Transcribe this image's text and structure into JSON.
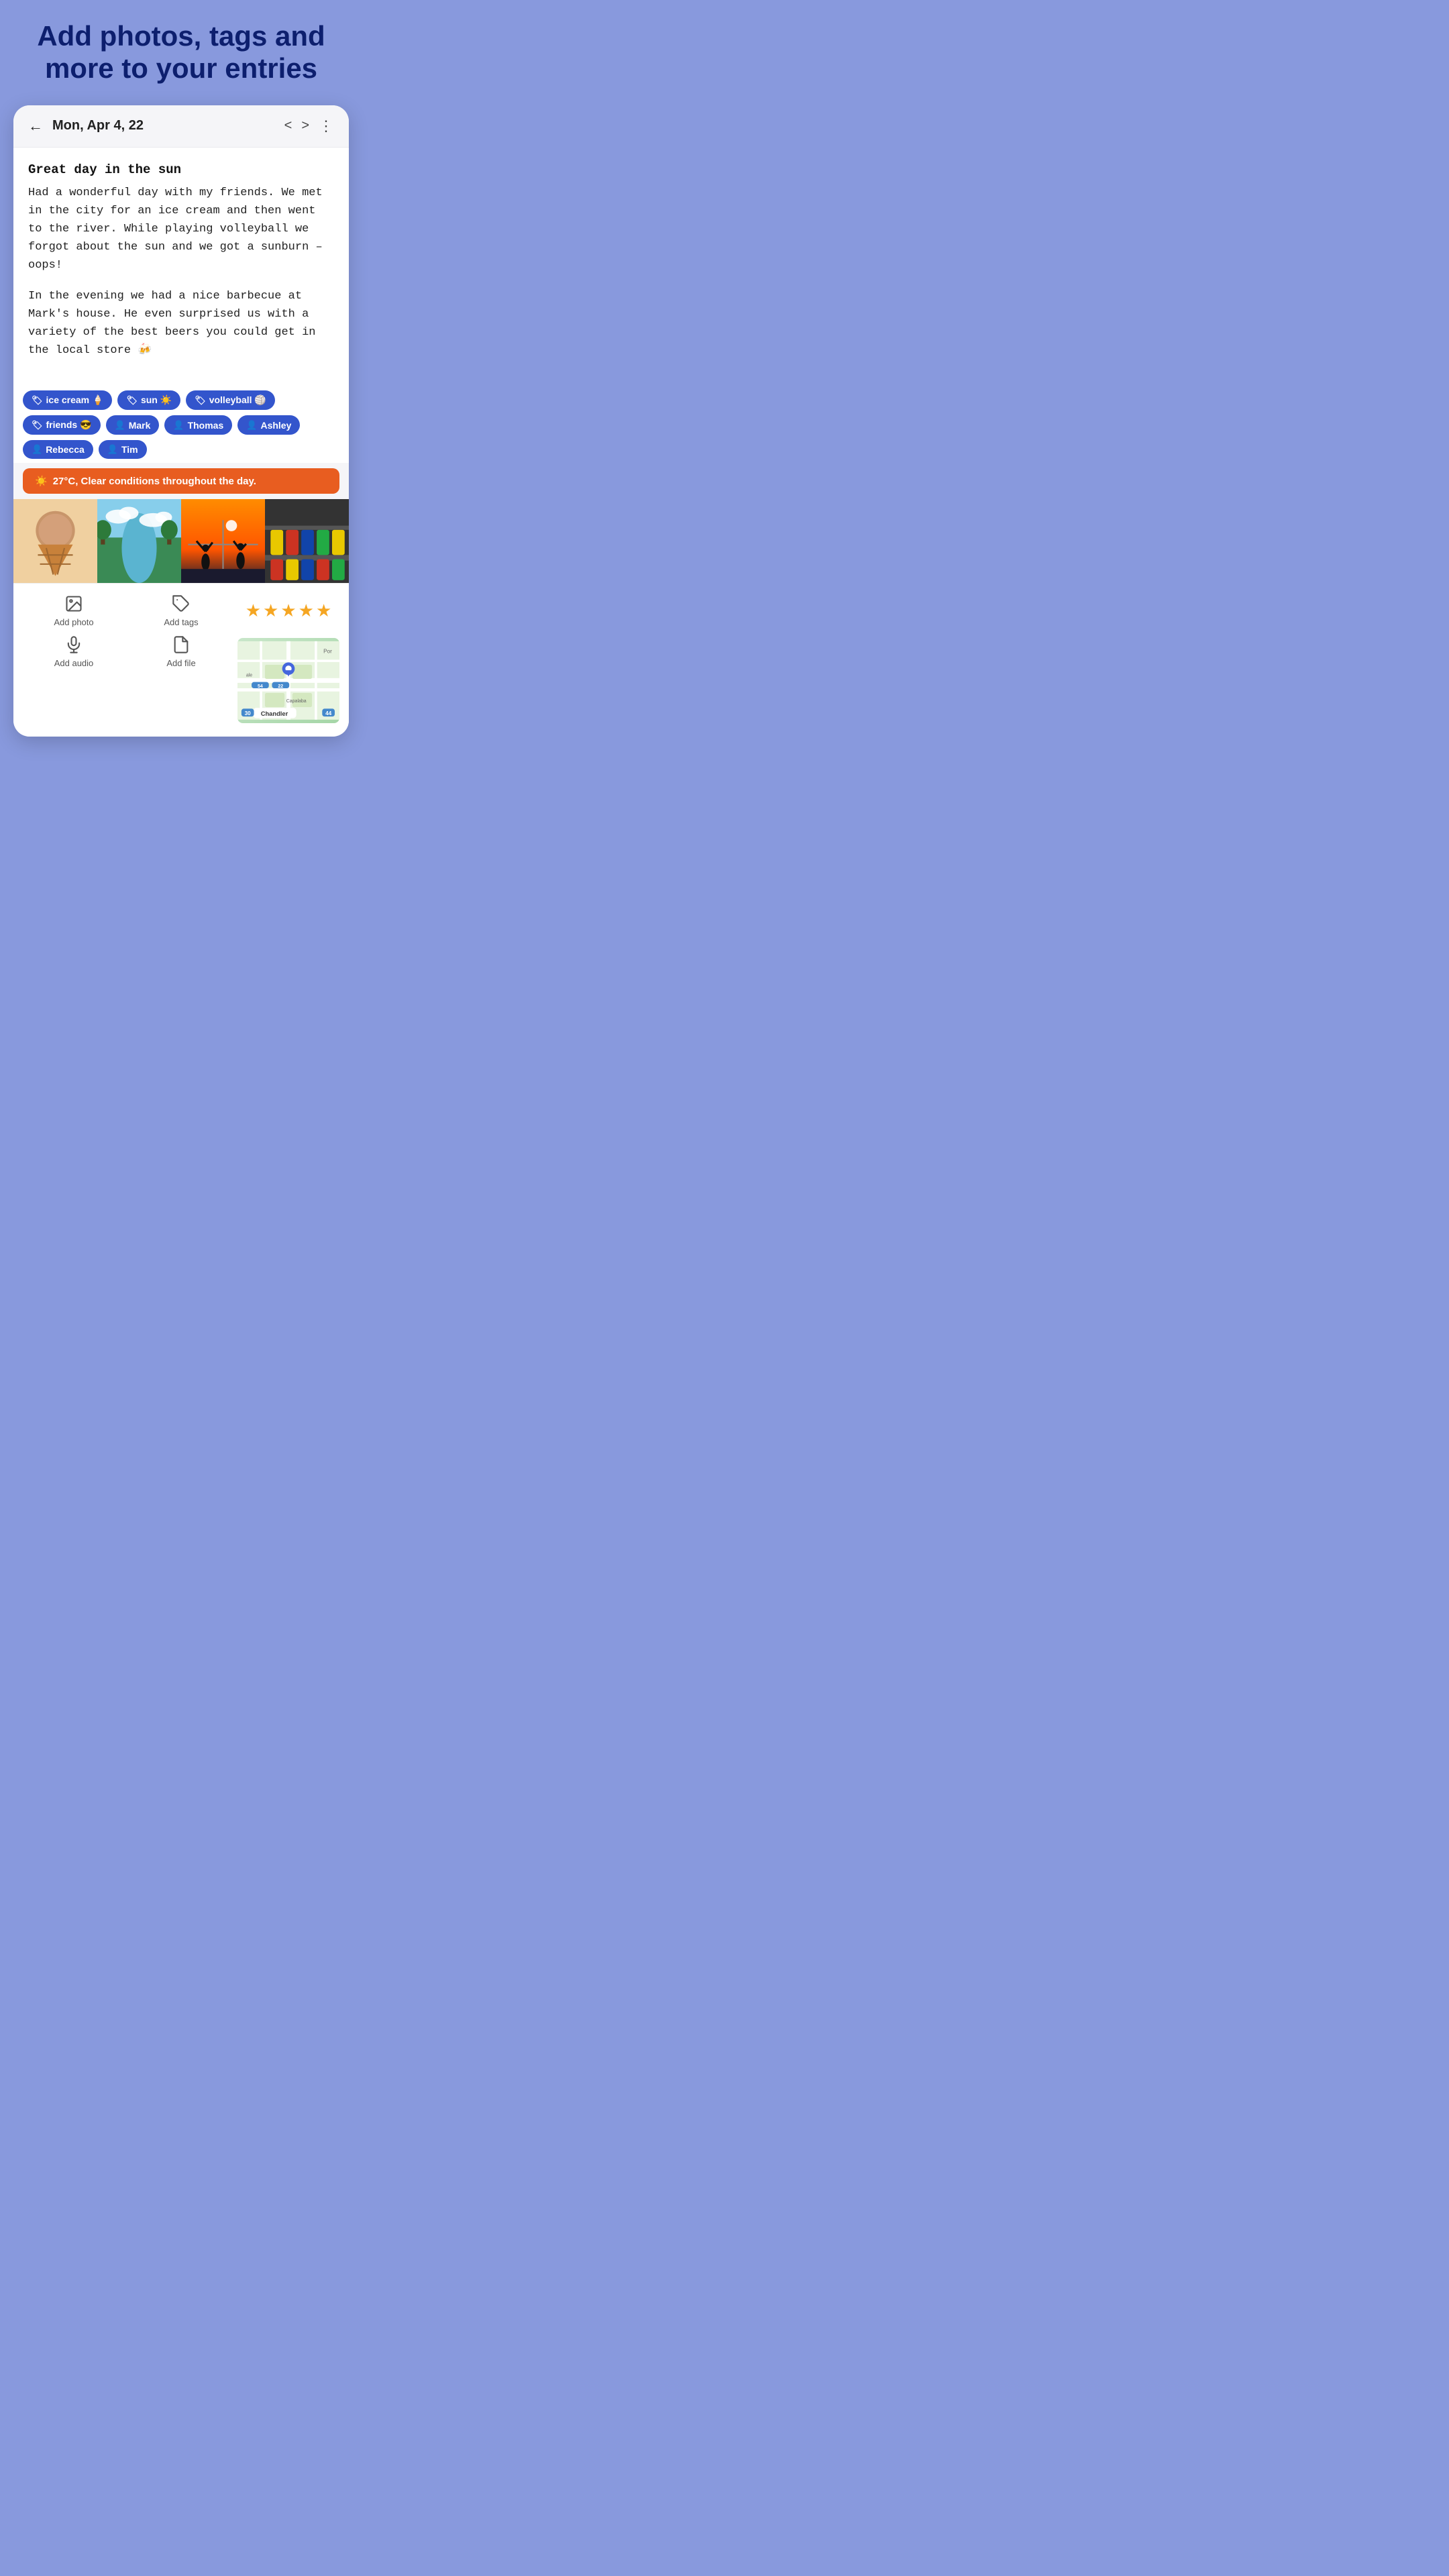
{
  "headline": "Add photos, tags and more to your entries",
  "header": {
    "date": "Mon, Apr 4, 22",
    "back_label": "←",
    "prev_label": "<",
    "next_label": ">",
    "more_label": "⋮"
  },
  "entry": {
    "title": "Great day in the sun",
    "paragraph1": "Had a wonderful day with my friends. We met in the city for an ice cream and then went to the river. While playing volleyball we forgot about the sun and we got a sunburn – oops!",
    "paragraph2": "In the evening we had a nice barbecue at Mark's house. He even surprised us with a variety of the best beers you could get in the local store 🍻"
  },
  "tags": [
    {
      "icon": "🏷",
      "label": "ice cream 🍦"
    },
    {
      "icon": "🏷",
      "label": "sun ☀️"
    },
    {
      "icon": "🏷",
      "label": "volleyball 🏐"
    },
    {
      "icon": "🏷",
      "label": "friends 😎"
    },
    {
      "icon": "👤",
      "label": "Mark"
    },
    {
      "icon": "👤",
      "label": "Thomas"
    },
    {
      "icon": "👤",
      "label": "Ashley"
    },
    {
      "icon": "👤",
      "label": "Rebecca"
    },
    {
      "icon": "👤",
      "label": "Tim"
    }
  ],
  "weather": {
    "icon": "☀️",
    "text": "27°C, Clear conditions throughout the day."
  },
  "photos": [
    {
      "type": "icecream",
      "emoji": "🍦",
      "alt": "ice cream cone"
    },
    {
      "type": "river",
      "emoji": "🌊",
      "alt": "river scene"
    },
    {
      "type": "volleyball",
      "emoji": "🏐",
      "alt": "volleyball silhouette"
    },
    {
      "type": "beer",
      "emoji": "🍺",
      "alt": "beer cans"
    }
  ],
  "actions_row1": [
    {
      "icon": "photo",
      "label": "Add photo"
    },
    {
      "icon": "tag",
      "label": "Add tags"
    }
  ],
  "stars": [
    "★",
    "★",
    "★",
    "★",
    "★"
  ],
  "actions_row2": [
    {
      "icon": "mic",
      "label": "Add audio"
    },
    {
      "icon": "file",
      "label": "Add file"
    }
  ],
  "map": {
    "label": "Chandler",
    "pin_label": "📍"
  },
  "colors": {
    "background": "#8899dd",
    "headline": "#0d1f6e",
    "tag_bg": "#3355cc",
    "weather_bg": "#e85d20"
  }
}
